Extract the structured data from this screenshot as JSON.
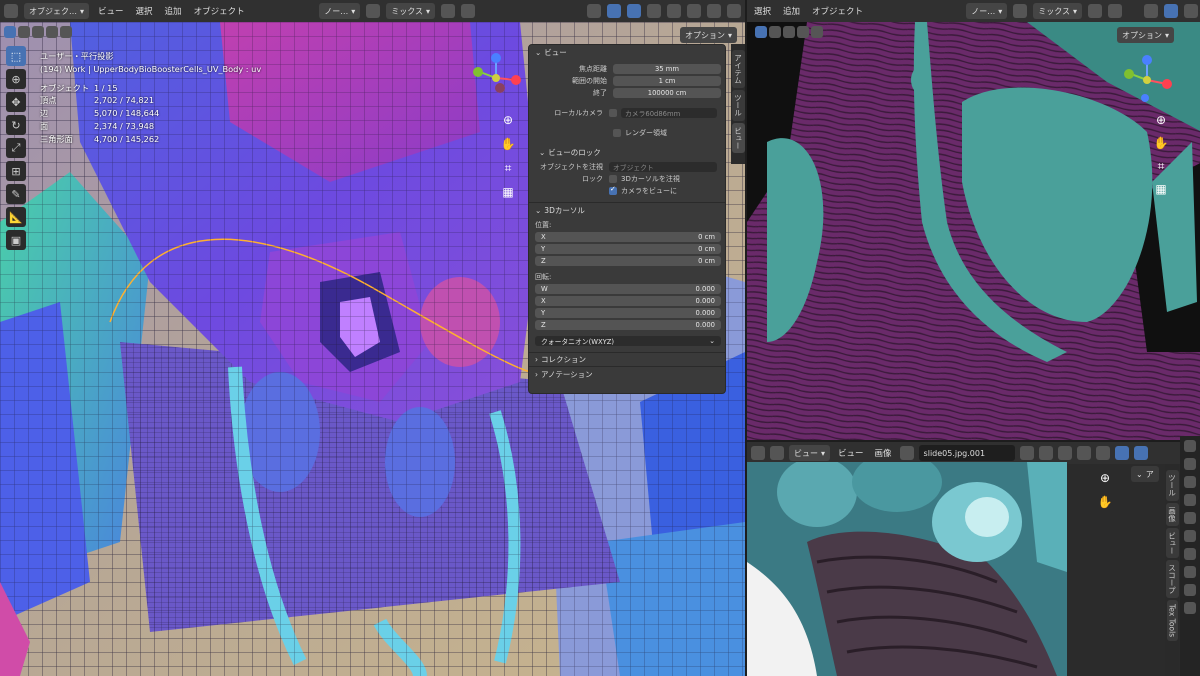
{
  "colors": {
    "header": "#303030",
    "accent": "#4772b3",
    "panel": "#3a3a3a"
  },
  "left_view": {
    "header": {
      "mode": "オブジェク…",
      "menus": [
        "ビュー",
        "選択",
        "追加",
        "オブジェクト"
      ],
      "pivot": "ノー…",
      "blend": "ミックス",
      "options": "オプション"
    },
    "overlay": {
      "line1": "ユーザー・平行投影",
      "line2": "(194) Work | UpperBodyBioBoosterCells_UV_Body : uv",
      "stats": [
        {
          "label": "オブジェクト",
          "value": "1 / 15"
        },
        {
          "label": "頂点",
          "value": "2,702 / 74,821"
        },
        {
          "label": "辺",
          "value": "5,070 / 148,644"
        },
        {
          "label": "面",
          "value": "2,374 / 73,948"
        },
        {
          "label": "三角形面",
          "value": "4,700 / 145,262"
        }
      ]
    }
  },
  "npanel": {
    "view_section": "ビュー",
    "focal_label": "焦点距離",
    "focal_value": "35 mm",
    "clip_start_label": "範囲の開始",
    "clip_start_value": "1 cm",
    "clip_end_label": "終了",
    "clip_end_value": "100000 cm",
    "local_camera_label": "ローカルカメラ",
    "local_camera_value": "カメラ60d86mm",
    "render_region": "レンダー領域",
    "view_lock_section": "ビューのロック",
    "lock_object_label": "オブジェクトを注視",
    "lock_object_placeholder": "オブジェクト",
    "lock_label": "ロック",
    "lock_cursor": "3Dカーソルを注視",
    "camera_to_view": "カメラをビューに",
    "cursor_section": "3Dカーソル",
    "location_label": "位置:",
    "location": [
      {
        "axis": "X",
        "value": "0 cm"
      },
      {
        "axis": "Y",
        "value": "0 cm"
      },
      {
        "axis": "Z",
        "value": "0 cm"
      }
    ],
    "rotation_label": "回転:",
    "rotation": [
      {
        "axis": "W",
        "value": "0.000"
      },
      {
        "axis": "X",
        "value": "0.000"
      },
      {
        "axis": "Y",
        "value": "0.000"
      },
      {
        "axis": "Z",
        "value": "0.000"
      }
    ],
    "rotation_mode": "クォータニオン(WXYZ)",
    "collection_section": "コレクション",
    "annotation_section": "アノテーション",
    "tabs": [
      "アイテム",
      "ツール",
      "ビュー"
    ]
  },
  "right_view": {
    "header": {
      "menus": [
        "選択",
        "追加",
        "オブジェクト"
      ],
      "pivot": "ノー…",
      "blend": "ミックス",
      "options": "オプション"
    }
  },
  "image_editor": {
    "header": {
      "view": "ビュー",
      "menus": [
        "ビュー",
        "画像"
      ],
      "image_name": "slide05.jpg.001"
    },
    "tabs": [
      "ツール",
      "画像",
      "ビュー",
      "スコープ",
      "Tex Tools"
    ],
    "small_label": "ア"
  }
}
